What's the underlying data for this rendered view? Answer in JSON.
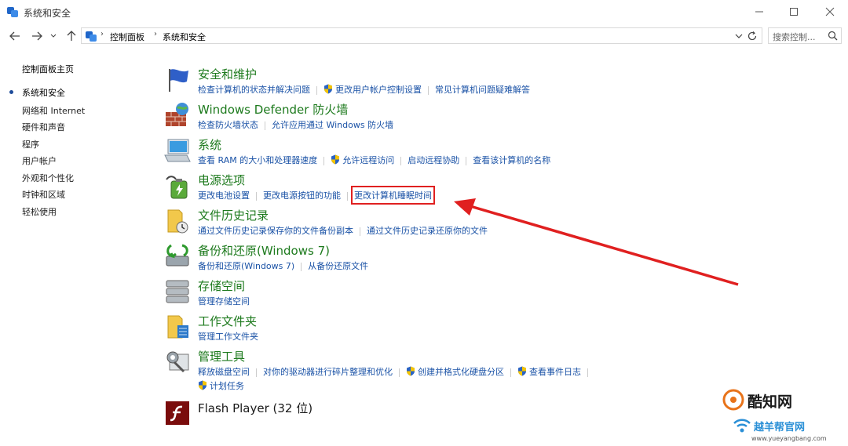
{
  "window": {
    "title": "系统和安全"
  },
  "address": {
    "crumbs": [
      "控制面板",
      "系统和安全"
    ],
    "search_placeholder": "搜索控制..."
  },
  "sidebar": {
    "home": "控制面板主页",
    "items": [
      {
        "label": "系统和安全",
        "active": true
      },
      {
        "label": "网络和 Internet"
      },
      {
        "label": "硬件和声音"
      },
      {
        "label": "程序"
      },
      {
        "label": "用户帐户"
      },
      {
        "label": "外观和个性化"
      },
      {
        "label": "时钟和区域"
      },
      {
        "label": "轻松使用"
      }
    ]
  },
  "categories": [
    {
      "title": "安全和维护",
      "icon": "flag-icon",
      "links": [
        {
          "text": "检查计算机的状态并解决问题"
        },
        {
          "text": "更改用户帐户控制设置",
          "shield": true
        },
        {
          "text": "常见计算机问题疑难解答"
        }
      ]
    },
    {
      "title": "Windows Defender 防火墙",
      "icon": "firewall-icon",
      "links": [
        {
          "text": "检查防火墙状态"
        },
        {
          "text": "允许应用通过 Windows 防火墙"
        }
      ]
    },
    {
      "title": "系统",
      "icon": "computer-icon",
      "links": [
        {
          "text": "查看 RAM 的大小和处理器速度"
        },
        {
          "text": "允许远程访问",
          "shield": true
        },
        {
          "text": "启动远程协助"
        },
        {
          "text": "查看该计算机的名称"
        }
      ]
    },
    {
      "title": "电源选项",
      "icon": "battery-icon",
      "links": [
        {
          "text": "更改电池设置"
        },
        {
          "text": "更改电源按钮的功能"
        },
        {
          "text": "更改计算机睡眠时间",
          "highlighted": true
        }
      ]
    },
    {
      "title": "文件历史记录",
      "icon": "file-history-icon",
      "links": [
        {
          "text": "通过文件历史记录保存你的文件备份副本"
        },
        {
          "text": "通过文件历史记录还原你的文件"
        }
      ]
    },
    {
      "title": "备份和还原(Windows 7)",
      "icon": "backup-icon",
      "links": [
        {
          "text": "备份和还原(Windows 7)"
        },
        {
          "text": "从备份还原文件"
        }
      ]
    },
    {
      "title": "存储空间",
      "icon": "storage-icon",
      "links": [
        {
          "text": "管理存储空间"
        }
      ]
    },
    {
      "title": "工作文件夹",
      "icon": "work-folder-icon",
      "links": [
        {
          "text": "管理工作文件夹"
        }
      ]
    },
    {
      "title": "管理工具",
      "icon": "admin-tools-icon",
      "links": [
        {
          "text": "释放磁盘空间"
        },
        {
          "text": "对你的驱动器进行碎片整理和优化"
        },
        {
          "text": "创建并格式化硬盘分区",
          "shield": true
        },
        {
          "text": "查看事件日志",
          "shield": true
        }
      ],
      "links2": [
        {
          "text": "计划任务",
          "shield": true
        }
      ]
    },
    {
      "title": "Flash Player (32 位)",
      "icon": "flash-icon",
      "links": []
    }
  ],
  "watermark": {
    "brand1": "酷知网",
    "brand2": "越羊帮官网",
    "url": "www.yueyangbang.com"
  },
  "colors": {
    "link": "#1a52a6",
    "category_title": "#1d7a1d",
    "highlight": "#e02020"
  }
}
